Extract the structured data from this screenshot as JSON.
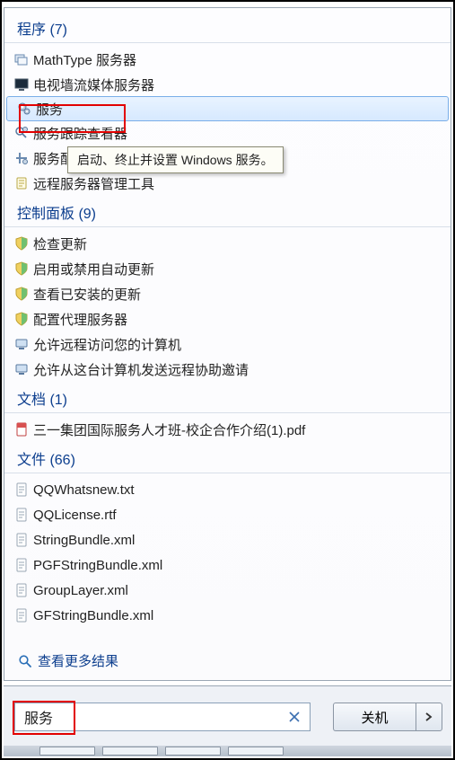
{
  "tooltip_text": "启动、终止并设置 Windows 服务。",
  "see_more_label": "查看更多结果",
  "search_value": "服务",
  "shutdown_label": "关机",
  "sections": {
    "programs": {
      "label": "程序 (7)",
      "items": [
        {
          "label": "MathType 服务器",
          "icon": "stack-icon"
        },
        {
          "label": "电视墙流媒体服务器",
          "icon": "display-icon"
        },
        {
          "label": "服务",
          "icon": "gears-icon",
          "selected": true
        },
        {
          "label": "服务跟踪查看器",
          "icon": "search-gear-icon"
        },
        {
          "label": "服务配置编辑器",
          "icon": "tools-icon"
        },
        {
          "label": "远程服务器管理工具",
          "icon": "script-icon"
        }
      ]
    },
    "control_panel": {
      "label": "控制面板 (9)",
      "items": [
        {
          "label": "检查更新",
          "icon": "shield-icon"
        },
        {
          "label": "启用或禁用自动更新",
          "icon": "shield-icon"
        },
        {
          "label": "查看已安装的更新",
          "icon": "shield-icon"
        },
        {
          "label": "配置代理服务器",
          "icon": "shield-icon"
        },
        {
          "label": "允许远程访问您的计算机",
          "icon": "computer-icon"
        },
        {
          "label": "允许从这台计算机发送远程协助邀请",
          "icon": "computer-icon"
        }
      ]
    },
    "documents": {
      "label": "文档 (1)",
      "items": [
        {
          "label": "三一集团国际服务人才班-校企合作介绍(1).pdf",
          "icon": "pdf-icon"
        }
      ]
    },
    "files": {
      "label": "文件 (66)",
      "items": [
        {
          "label": "QQWhatsnew.txt",
          "icon": "text-file-icon"
        },
        {
          "label": "QQLicense.rtf",
          "icon": "rtf-file-icon"
        },
        {
          "label": "StringBundle.xml",
          "icon": "xml-file-icon"
        },
        {
          "label": "PGFStringBundle.xml",
          "icon": "xml-file-icon"
        },
        {
          "label": "GroupLayer.xml",
          "icon": "xml-file-icon"
        },
        {
          "label": "GFStringBundle.xml",
          "icon": "xml-file-icon"
        }
      ]
    }
  }
}
